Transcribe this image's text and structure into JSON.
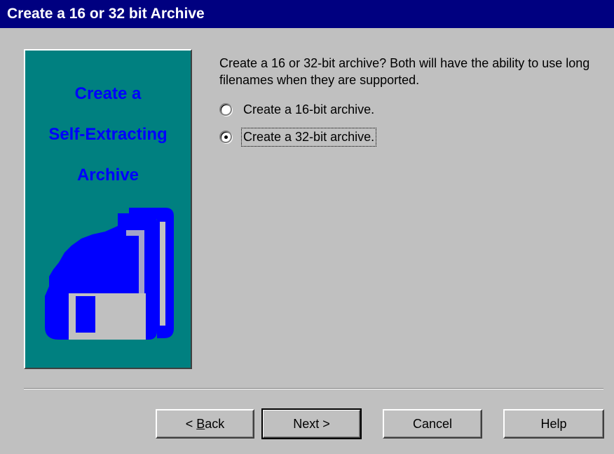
{
  "window": {
    "title": "Create a 16 or 32 bit Archive"
  },
  "banner": {
    "line1": "Create a",
    "line2": "Self-Extracting",
    "line3": "Archive",
    "icon": "floppy-disk-icon",
    "background_color": "#008080",
    "text_color": "#0000ff"
  },
  "content": {
    "description": "Create a 16 or 32-bit archive?  Both will have the ability to use long filenames when they are supported.",
    "options": [
      {
        "label": "Create a 16-bit archive.",
        "selected": false
      },
      {
        "label": "Create a 32-bit archive.",
        "selected": true
      }
    ]
  },
  "buttons": {
    "back_prefix": "< ",
    "back_mnemonic": "B",
    "back_rest": "ack",
    "next": "Next >",
    "cancel": "Cancel",
    "help": "Help"
  },
  "colors": {
    "title_bar": "#000080",
    "dialog": "#c0c0c0"
  }
}
